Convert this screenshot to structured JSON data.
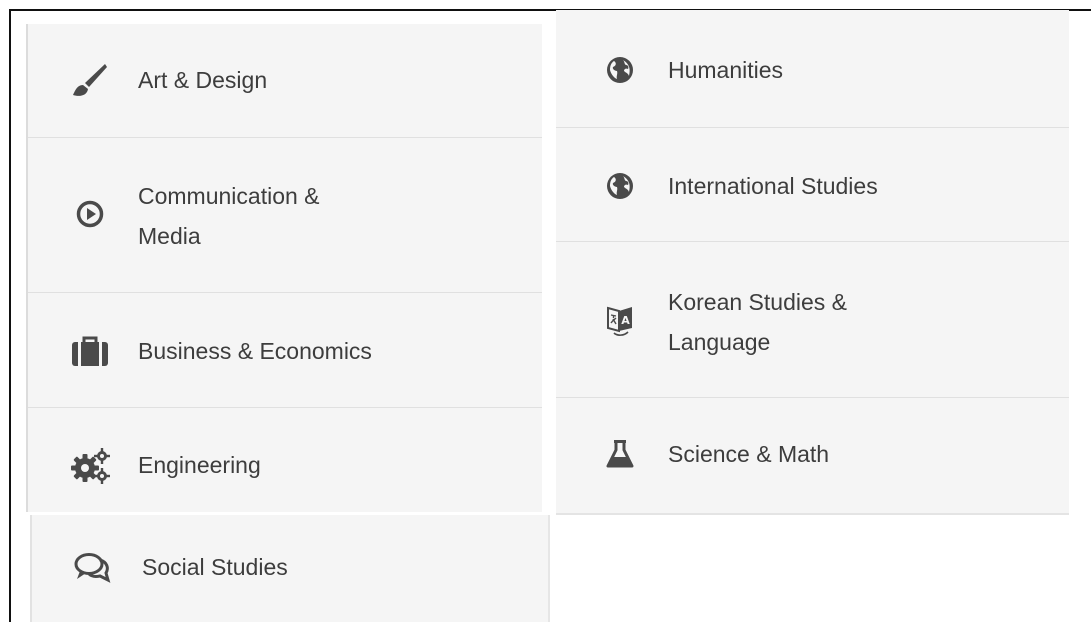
{
  "left_column": {
    "items": [
      {
        "label": "Art & Design",
        "icon": "paintbrush-icon"
      },
      {
        "label": "Communication &",
        "label_line2": "Media",
        "icon": "play-circle-icon"
      },
      {
        "label": "Business & Economics",
        "icon": "briefcase-icon"
      },
      {
        "label": "Engineering",
        "icon": "gears-icon"
      },
      {
        "label": "Social Studies",
        "icon": "speech-bubbles-icon"
      }
    ]
  },
  "right_column": {
    "items": [
      {
        "label": "Humanities",
        "icon": "globe-icon"
      },
      {
        "label": "International Studies",
        "icon": "globe-icon"
      },
      {
        "label": "Korean Studies &",
        "label_line2": "Language",
        "icon": "translate-icon"
      },
      {
        "label": "Science & Math",
        "icon": "flask-icon"
      }
    ]
  },
  "colors": {
    "panel_bg": "#f5f5f5",
    "divider": "#e0e0e0",
    "text": "#3d3d3d",
    "icon": "#4a4a4a"
  }
}
